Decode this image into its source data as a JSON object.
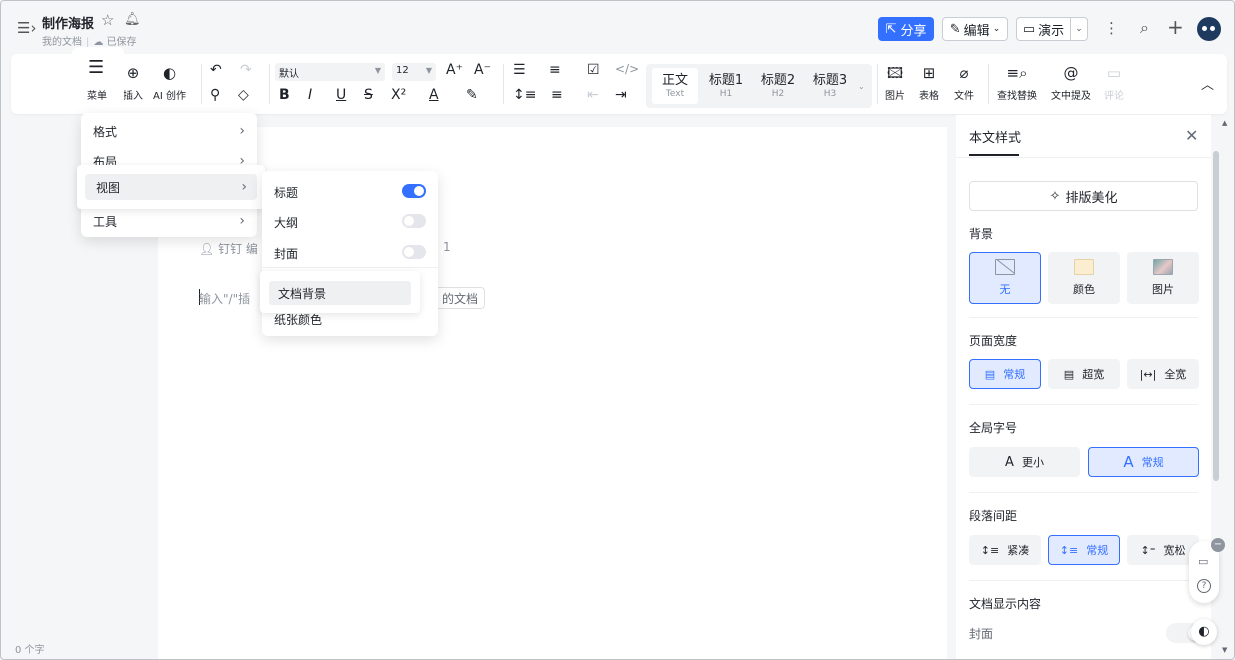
{
  "header": {
    "title": "制作海报",
    "breadcrumb": "我的文档",
    "save_status": "已保存",
    "share_label": "分享",
    "edit_label": "编辑",
    "present_label": "演示"
  },
  "toolbar": {
    "menu_label": "菜单",
    "insert_label": "插入",
    "ai_label": "AI 创作",
    "font_family": "默认",
    "font_size": "12",
    "styles": [
      {
        "label": "正文",
        "sub": "Text"
      },
      {
        "label": "标题1",
        "sub": "H1"
      },
      {
        "label": "标题2",
        "sub": "H2"
      },
      {
        "label": "标题3",
        "sub": "H3"
      }
    ],
    "image_label": "图片",
    "table_label": "表格",
    "file_label": "文件",
    "find_label": "查找替换",
    "mention_label": "文中提及",
    "comment_label": "评论"
  },
  "menu": {
    "items": [
      "格式",
      "布局",
      "视图",
      "工具"
    ],
    "view_submenu": {
      "toggles": [
        {
          "label": "标题",
          "on": true
        },
        {
          "label": "大纲",
          "on": false
        },
        {
          "label": "封面",
          "on": false
        }
      ],
      "doc_background": "文档背景",
      "paper_color": "纸张颜色"
    }
  },
  "doc": {
    "author_hint": "钉钉 编",
    "author_suffix": "1",
    "input_hint": "输入\"/\"插",
    "template_tag": "的文档",
    "word_count": "0 个字"
  },
  "panel": {
    "title": "本文样式",
    "beautify_label": "排版美化",
    "background": {
      "label": "背景",
      "options": [
        "无",
        "颜色",
        "图片"
      ],
      "selected": "无"
    },
    "page_width": {
      "label": "页面宽度",
      "options": [
        "常规",
        "超宽",
        "全宽"
      ],
      "selected": "常规"
    },
    "font_size": {
      "label": "全局字号",
      "options": [
        "更小",
        "常规"
      ],
      "selected": "常规"
    },
    "paragraph_spacing": {
      "label": "段落间距",
      "options": [
        "紧凑",
        "常规",
        "宽松"
      ],
      "selected": "常规"
    },
    "display_content": {
      "label": "文档显示内容",
      "cover_label": "封面"
    }
  },
  "colors": {
    "accent": "#3370ff",
    "toggle_off": "#e5e6eb"
  }
}
